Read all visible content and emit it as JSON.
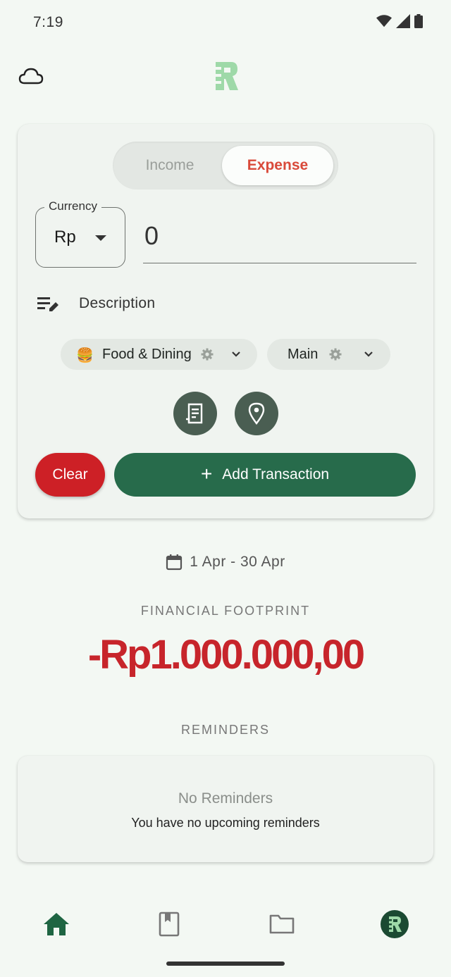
{
  "status_bar": {
    "time": "7:19"
  },
  "form": {
    "type_toggle": {
      "income_label": "Income",
      "expense_label": "Expense",
      "selected": "Expense"
    },
    "currency": {
      "label": "Currency",
      "value": "Rp"
    },
    "amount": "0",
    "description_placeholder": "Description",
    "category": {
      "emoji": "🍔",
      "label": "Food & Dining"
    },
    "account": {
      "label": "Main"
    },
    "clear_label": "Clear",
    "add_label": "Add Transaction"
  },
  "summary": {
    "date_range": "1 Apr - 30 Apr",
    "footprint_label": "FINANCIAL FOOTPRINT",
    "footprint_amount": "-Rp1.000.000,00"
  },
  "reminders": {
    "section_label": "REMINDERS",
    "empty_title": "No Reminders",
    "empty_subtitle": "You have no upcoming reminders"
  },
  "nav": {
    "items": [
      "home-icon",
      "book-icon",
      "folder-icon",
      "app-logo-icon"
    ],
    "active": "home-icon"
  },
  "colors": {
    "primary_green": "#276b4b",
    "expense_red": "#d94a3a",
    "danger_red": "#cd2026",
    "background": "#f3f8f3"
  }
}
